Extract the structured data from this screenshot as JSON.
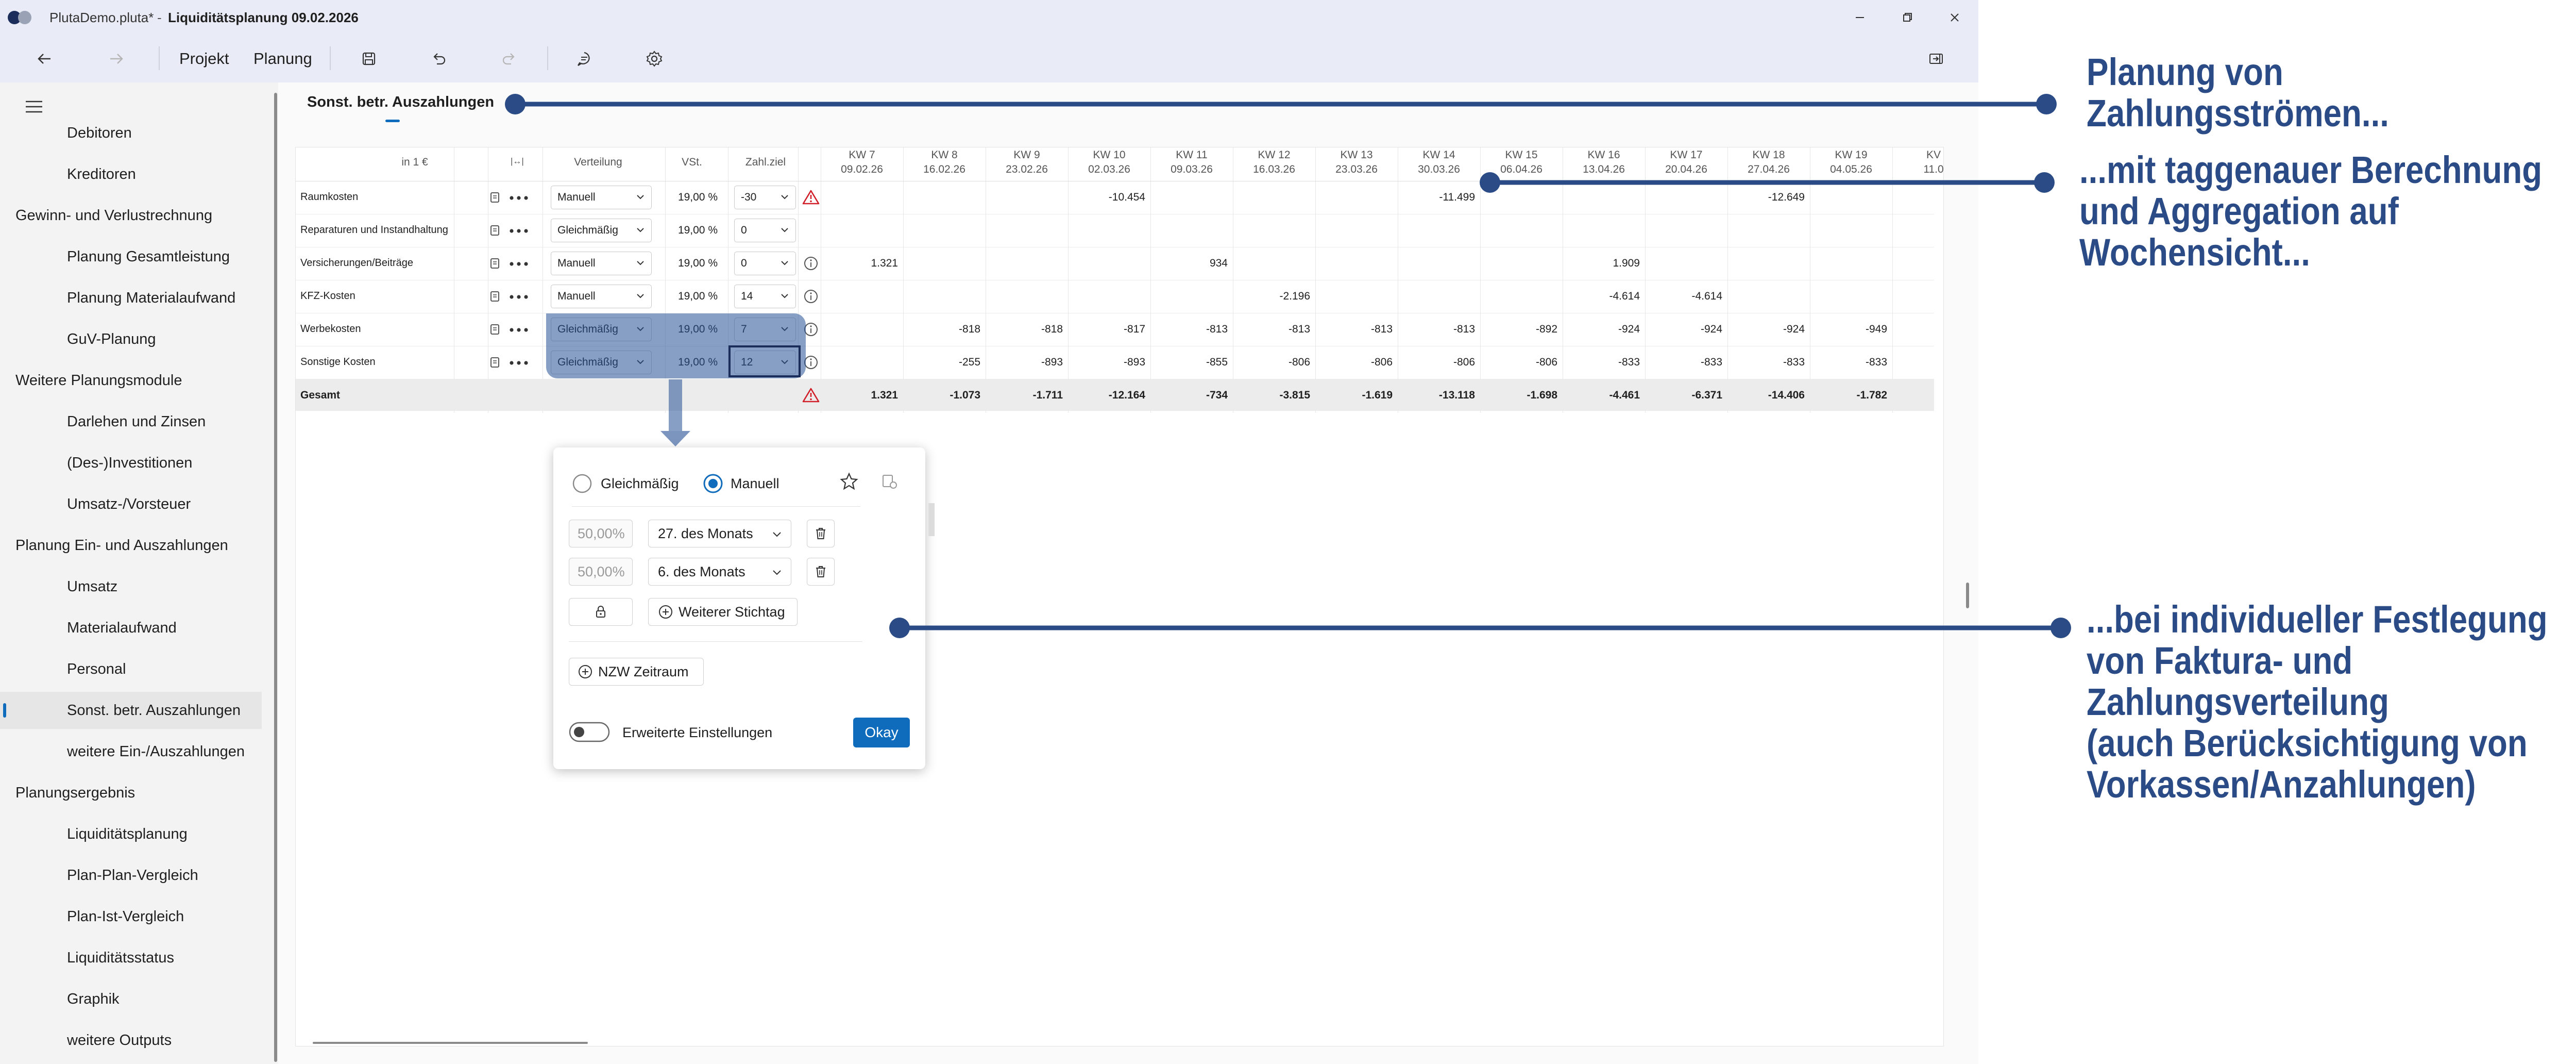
{
  "window": {
    "file": "PlutaDemo.pluta*",
    "title": "Liquiditätsplanung 09.02.2026"
  },
  "toolbar": {
    "projekt": "Projekt",
    "planung": "Planung"
  },
  "sidebar": {
    "items": [
      {
        "label": "Debitoren",
        "level": 1
      },
      {
        "label": "Kreditoren",
        "level": 1
      },
      {
        "label": "Gewinn- und Verlustrechnung",
        "level": 0
      },
      {
        "label": "Planung Gesamtleistung",
        "level": 1
      },
      {
        "label": "Planung Materialaufwand",
        "level": 1
      },
      {
        "label": "GuV-Planung",
        "level": 1
      },
      {
        "label": "Weitere Planungsmodule",
        "level": 0
      },
      {
        "label": "Darlehen und Zinsen",
        "level": 1
      },
      {
        "label": "(Des-)Investitionen",
        "level": 1
      },
      {
        "label": "Umsatz-/Vorsteuer",
        "level": 1
      },
      {
        "label": "Planung Ein- und Auszahlungen",
        "level": 0
      },
      {
        "label": "Umsatz",
        "level": 1
      },
      {
        "label": "Materialaufwand",
        "level": 1
      },
      {
        "label": "Personal",
        "level": 1
      },
      {
        "label": "Sonst. betr. Auszahlungen",
        "level": 1,
        "selected": true
      },
      {
        "label": "weitere Ein-/Auszahlungen",
        "level": 1
      },
      {
        "label": "Planungsergebnis",
        "level": 0
      },
      {
        "label": "Liquiditätsplanung",
        "level": 1
      },
      {
        "label": "Plan-Plan-Vergleich",
        "level": 1
      },
      {
        "label": "Plan-Ist-Vergleich",
        "level": 1
      },
      {
        "label": "Liquiditätsstatus",
        "level": 1
      },
      {
        "label": "Graphik",
        "level": 1
      },
      {
        "label": "weitere Outputs",
        "level": 1
      }
    ]
  },
  "page": {
    "tab": "Sonst. betr. Auszahlungen"
  },
  "table": {
    "unit": "in 1 €",
    "range_symbol": "|↔|",
    "headers": {
      "verteilung": "Verteilung",
      "vst": "VSt.",
      "zahlziel": "Zahl.ziel"
    },
    "weeks": [
      {
        "kw": "KW 7",
        "date": "09.02.26"
      },
      {
        "kw": "KW 8",
        "date": "16.02.26"
      },
      {
        "kw": "KW 9",
        "date": "23.02.26"
      },
      {
        "kw": "KW 10",
        "date": "02.03.26"
      },
      {
        "kw": "KW 11",
        "date": "09.03.26"
      },
      {
        "kw": "KW 12",
        "date": "16.03.26"
      },
      {
        "kw": "KW 13",
        "date": "23.03.26"
      },
      {
        "kw": "KW 14",
        "date": "30.03.26"
      },
      {
        "kw": "KW 15",
        "date": "06.04.26"
      },
      {
        "kw": "KW 16",
        "date": "13.04.26"
      },
      {
        "kw": "KW 17",
        "date": "20.04.26"
      },
      {
        "kw": "KW 18",
        "date": "27.04.26"
      },
      {
        "kw": "KW 19",
        "date": "04.05.26"
      },
      {
        "kw": "KV",
        "date": "11.0"
      }
    ],
    "rows": [
      {
        "name": "Raumkosten",
        "verteilung": "Manuell",
        "vst": "19,00 %",
        "zahlziel": "-30",
        "status": "warning",
        "values": [
          "",
          "",
          "",
          "-10.454",
          "",
          "",
          "",
          "-11.499",
          "",
          "",
          "",
          "-12.649",
          "",
          ""
        ]
      },
      {
        "name": "Reparaturen und Instandhaltung",
        "verteilung": "Gleichmäßig",
        "vst": "19,00 %",
        "zahlziel": "0",
        "status": "",
        "values": [
          "",
          "",
          "",
          "",
          "",
          "",
          "",
          "",
          "",
          "",
          "",
          "",
          "",
          ""
        ]
      },
      {
        "name": "Versicherungen/Beiträge",
        "verteilung": "Manuell",
        "vst": "19,00 %",
        "zahlziel": "0",
        "status": "info",
        "values": [
          "1.321",
          "",
          "",
          "",
          "934",
          "",
          "",
          "",
          "",
          "1.909",
          "",
          "",
          "",
          ""
        ]
      },
      {
        "name": "KFZ-Kosten",
        "verteilung": "Manuell",
        "vst": "19,00 %",
        "zahlziel": "14",
        "status": "info",
        "values": [
          "",
          "",
          "",
          "",
          "",
          "-2.196",
          "",
          "",
          "",
          "-4.614",
          "-4.614",
          "",
          "",
          ""
        ]
      },
      {
        "name": "Werbekosten",
        "verteilung": "Gleichmäßig",
        "vst": "19,00 %",
        "zahlziel": "7",
        "status": "info",
        "values": [
          "",
          "-818",
          "-818",
          "-817",
          "-813",
          "-813",
          "-813",
          "-813",
          "-892",
          "-924",
          "-924",
          "-924",
          "-949",
          ""
        ]
      },
      {
        "name": "Sonstige Kosten",
        "verteilung": "Gleichmäßig",
        "vst": "19,00 %",
        "zahlziel": "12",
        "status": "info",
        "values": [
          "",
          "-255",
          "-893",
          "-893",
          "-855",
          "-806",
          "-806",
          "-806",
          "-806",
          "-833",
          "-833",
          "-833",
          "-833",
          ""
        ]
      }
    ],
    "total": {
      "name": "Gesamt",
      "status": "warning",
      "values": [
        "1.321",
        "-1.073",
        "-1.711",
        "-12.164",
        "-734",
        "-3.815",
        "-1.619",
        "-13.118",
        "-1.698",
        "-4.461",
        "-6.371",
        "-14.406",
        "-1.782",
        ""
      ]
    }
  },
  "popup": {
    "option_equal": "Gleichmäßig",
    "option_manual": "Manuell",
    "selected": "Manuell",
    "rows": [
      {
        "percent": "50,00%",
        "day": "27. des Monats"
      },
      {
        "percent": "50,00%",
        "day": "6. des Monats"
      }
    ],
    "add_day": "Weiterer Stichtag",
    "nzw": "NZW Zeitraum",
    "advanced": "Erweiterte Einstellungen",
    "ok": "Okay"
  },
  "annotations": {
    "a1": [
      "Planung von",
      "Zahlungsströmen..."
    ],
    "a2": [
      "...mit taggenauer Berechnung",
      "und Aggregation auf",
      "Wochensicht..."
    ],
    "a3": [
      "...bei individueller Festlegung",
      "von Faktura- und",
      "Zahlungsverteilung",
      "(auch Berücksichtigung von",
      "Vorkassen/Anzahlungen)"
    ],
    "color": "#2b4b86"
  }
}
